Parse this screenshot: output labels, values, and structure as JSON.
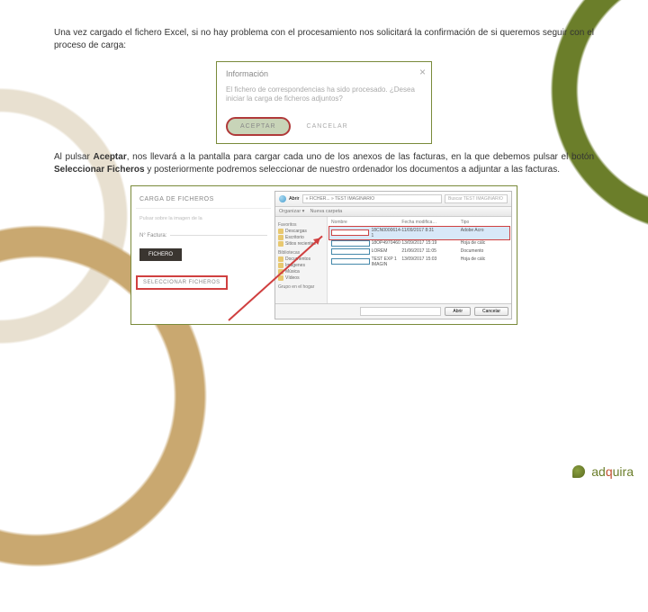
{
  "para1_a": "Una vez cargado el fichero Excel, si no hay problema con el procesamiento nos solicitará la confirmación de si queremos seguir con el proceso de carga:",
  "dialog": {
    "title": "Información",
    "close": "×",
    "msg": "El fichero de correspondencias ha sido procesado. ¿Desea iniciar la carga de ficheros adjuntos?",
    "accept": "ACEPTAR",
    "cancel": "CANCELAR"
  },
  "para2_a": "Al pulsar ",
  "para2_b": "Aceptar",
  "para2_c": ", nos llevará a la pantalla para cargar cada uno de los anexos de las facturas, en la que debemos pulsar el botón ",
  "para2_d": "Seleccionar Ficheros",
  "para2_e": " y posteriormente podremos seleccionar de nuestro ordenador los documentos a adjuntar a las facturas.",
  "panel": {
    "title": "CARGA DE FICHEROS",
    "sub": "Pulsar sobre la imagen de la",
    "lbl": "N° Factura:",
    "black": "FICHERO",
    "select": "SELECCIONAR FICHEROS"
  },
  "fd": {
    "window": "Abrir",
    "addr": "« FICHER... » TEST IMAGINARIO",
    "search_ph": "Buscar TEST IMAGINARIO",
    "org": "Organizar ▾",
    "newf": "Nueva carpeta",
    "fav": "Favoritos",
    "fav_items": [
      "Descargas",
      "Escritorio",
      "Sitios recientes"
    ],
    "lib": "Bibliotecas",
    "lib_items": [
      "Documentos",
      "Imágenes",
      "Música",
      "Vídeos"
    ],
    "grp": "Grupo en el hogar",
    "cols": [
      "Nombre",
      "Fecha modifica…",
      "Tipo"
    ],
    "rows": [
      {
        "n": "18CN0000614-1",
        "d": "11/09/2017 8:31",
        "t": "Adobe Acro"
      },
      {
        "n": "18OP4970460",
        "d": "13/09/2017 15:19",
        "t": "Hoja de cálc"
      },
      {
        "n": "LOREM",
        "d": "21/06/2017 11:05",
        "t": "Documento"
      },
      {
        "n": "TEST EXP 1 IMAGIN",
        "d": "13/09/2017 15:03",
        "t": "Hoja de cálc"
      }
    ],
    "open": "Abrir",
    "cancel": "Cancelar"
  },
  "logo_a": "ad",
  "logo_b": "q",
  "logo_c": "uira"
}
